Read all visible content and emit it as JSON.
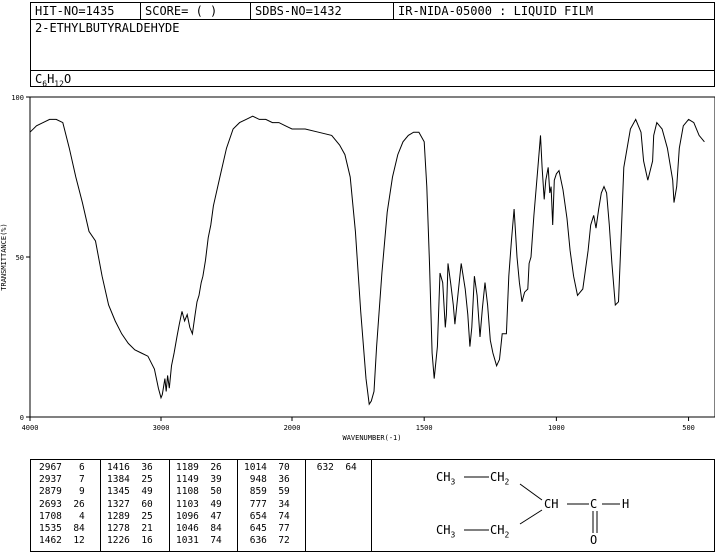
{
  "header": {
    "hit_no": "HIT-NO=1435",
    "score": "SCORE=  (  )",
    "sdbs_no": "SDBS-NO=1432",
    "method": "IR-NIDA-05000 : LIQUID FILM",
    "compound": "2-ETHYLBUTYRALDEHYDE",
    "formula": {
      "c": "C",
      "c_n": "6",
      "h": "H",
      "h_n": "12",
      "o": "O"
    }
  },
  "chart_data": {
    "type": "line",
    "xlabel": "WAVENUMBER(-1)",
    "ylabel": "TRANSMITTANCE(%)",
    "xlim": [
      4000,
      400
    ],
    "ylim": [
      0,
      100
    ],
    "x_ticks": [
      "4000",
      "3000",
      "2000",
      "1500",
      "1000",
      "500"
    ],
    "x_tick_values": [
      4000,
      3000,
      2000,
      1500,
      1000,
      500
    ],
    "y_ticks": [
      "0",
      "50",
      "100"
    ],
    "y_tick_values": [
      0,
      50,
      100
    ],
    "line_color": "#000000",
    "x": [
      4000,
      3950,
      3900,
      3850,
      3800,
      3750,
      3700,
      3650,
      3600,
      3550,
      3500,
      3450,
      3400,
      3350,
      3300,
      3250,
      3200,
      3150,
      3100,
      3050,
      3020,
      3000,
      2990,
      2970,
      2960,
      2950,
      2937,
      2920,
      2900,
      2879,
      2860,
      2840,
      2820,
      2800,
      2780,
      2760,
      2740,
      2725,
      2710,
      2693,
      2680,
      2660,
      2640,
      2620,
      2600,
      2550,
      2500,
      2450,
      2400,
      2350,
      2300,
      2250,
      2200,
      2150,
      2100,
      2050,
      2000,
      1950,
      1900,
      1850,
      1820,
      1800,
      1780,
      1760,
      1740,
      1720,
      1708,
      1700,
      1690,
      1680,
      1660,
      1640,
      1620,
      1600,
      1580,
      1560,
      1540,
      1520,
      1500,
      1490,
      1480,
      1470,
      1462,
      1450,
      1440,
      1430,
      1420,
      1416,
      1410,
      1400,
      1390,
      1384,
      1375,
      1360,
      1345,
      1335,
      1327,
      1320,
      1310,
      1300,
      1289,
      1280,
      1270,
      1260,
      1250,
      1240,
      1226,
      1215,
      1205,
      1189,
      1180,
      1170,
      1160,
      1149,
      1140,
      1130,
      1120,
      1108,
      1103,
      1096,
      1085,
      1070,
      1060,
      1054,
      1046,
      1040,
      1031,
      1025,
      1020,
      1014,
      1008,
      1000,
      990,
      975,
      960,
      948,
      935,
      920,
      900,
      880,
      870,
      859,
      850,
      840,
      830,
      820,
      810,
      800,
      790,
      777,
      765,
      755,
      745,
      720,
      700,
      680,
      670,
      654,
      645,
      636,
      632,
      620,
      600,
      580,
      560,
      555,
      545,
      535,
      520,
      500,
      480,
      460,
      440,
      420,
      400
    ],
    "y": [
      89,
      91,
      92,
      93,
      93,
      92,
      84,
      75,
      67,
      58,
      55,
      44,
      35,
      30,
      26,
      23,
      21,
      20,
      19,
      15,
      9,
      6,
      7,
      12,
      8,
      13,
      9,
      16,
      20,
      25,
      29,
      33,
      30,
      32,
      28,
      26,
      32,
      36,
      38,
      42,
      44,
      49,
      56,
      60,
      66,
      75,
      84,
      90,
      92,
      93,
      94,
      93,
      93,
      92,
      92,
      91,
      90,
      90,
      89,
      88,
      85,
      82,
      75,
      58,
      33,
      12,
      4,
      5,
      8,
      22,
      45,
      64,
      75,
      82,
      86,
      88,
      89,
      89,
      86,
      72,
      48,
      20,
      12,
      22,
      45,
      42,
      28,
      32,
      48,
      42,
      35,
      29,
      36,
      48,
      40,
      32,
      22,
      28,
      44,
      38,
      25,
      34,
      42,
      35,
      24,
      20,
      16,
      18,
      26,
      26,
      44,
      55,
      65,
      50,
      42,
      36,
      39,
      40,
      48,
      50,
      63,
      78,
      88,
      78,
      68,
      74,
      78,
      70,
      72,
      60,
      74,
      76,
      77,
      71,
      62,
      52,
      44,
      38,
      40,
      52,
      60,
      63,
      59,
      65,
      70,
      72,
      70,
      60,
      48,
      35,
      36,
      56,
      78,
      90,
      93,
      89,
      80,
      74,
      77,
      80,
      88,
      92,
      90,
      84,
      74,
      67,
      72,
      84,
      91,
      93,
      92,
      88,
      86
    ]
  },
  "peaks": [
    [
      [
        "2967",
        "6"
      ],
      [
        "2937",
        "7"
      ],
      [
        "2879",
        "9"
      ],
      [
        "2693",
        "26"
      ],
      [
        "1708",
        "4"
      ],
      [
        "1535",
        "84"
      ],
      [
        "1462",
        "12"
      ]
    ],
    [
      [
        "1416",
        "36"
      ],
      [
        "1384",
        "25"
      ],
      [
        "1345",
        "49"
      ],
      [
        "1327",
        "60"
      ],
      [
        "1289",
        "25"
      ],
      [
        "1278",
        "21"
      ],
      [
        "1226",
        "16"
      ]
    ],
    [
      [
        "1189",
        "26"
      ],
      [
        "1149",
        "39"
      ],
      [
        "1108",
        "50"
      ],
      [
        "1103",
        "49"
      ],
      [
        "1096",
        "47"
      ],
      [
        "1046",
        "84"
      ],
      [
        "1031",
        "74"
      ]
    ],
    [
      [
        "1014",
        "70"
      ],
      [
        "948",
        "36"
      ],
      [
        "859",
        "59"
      ],
      [
        "777",
        "34"
      ],
      [
        "654",
        "74"
      ],
      [
        "645",
        "77"
      ],
      [
        "636",
        "72"
      ]
    ],
    [
      [
        "632",
        "64"
      ]
    ]
  ],
  "structure": {
    "ch3_top": "CH",
    "ch3_top_sub": "3",
    "ch2_top": "CH",
    "ch2_top_sub": "2",
    "ch": "CH",
    "c": "C",
    "h": "H",
    "o": "O",
    "ch3_bot": "CH",
    "ch3_bot_sub": "3",
    "ch2_bot": "CH",
    "ch2_bot_sub": "2"
  }
}
